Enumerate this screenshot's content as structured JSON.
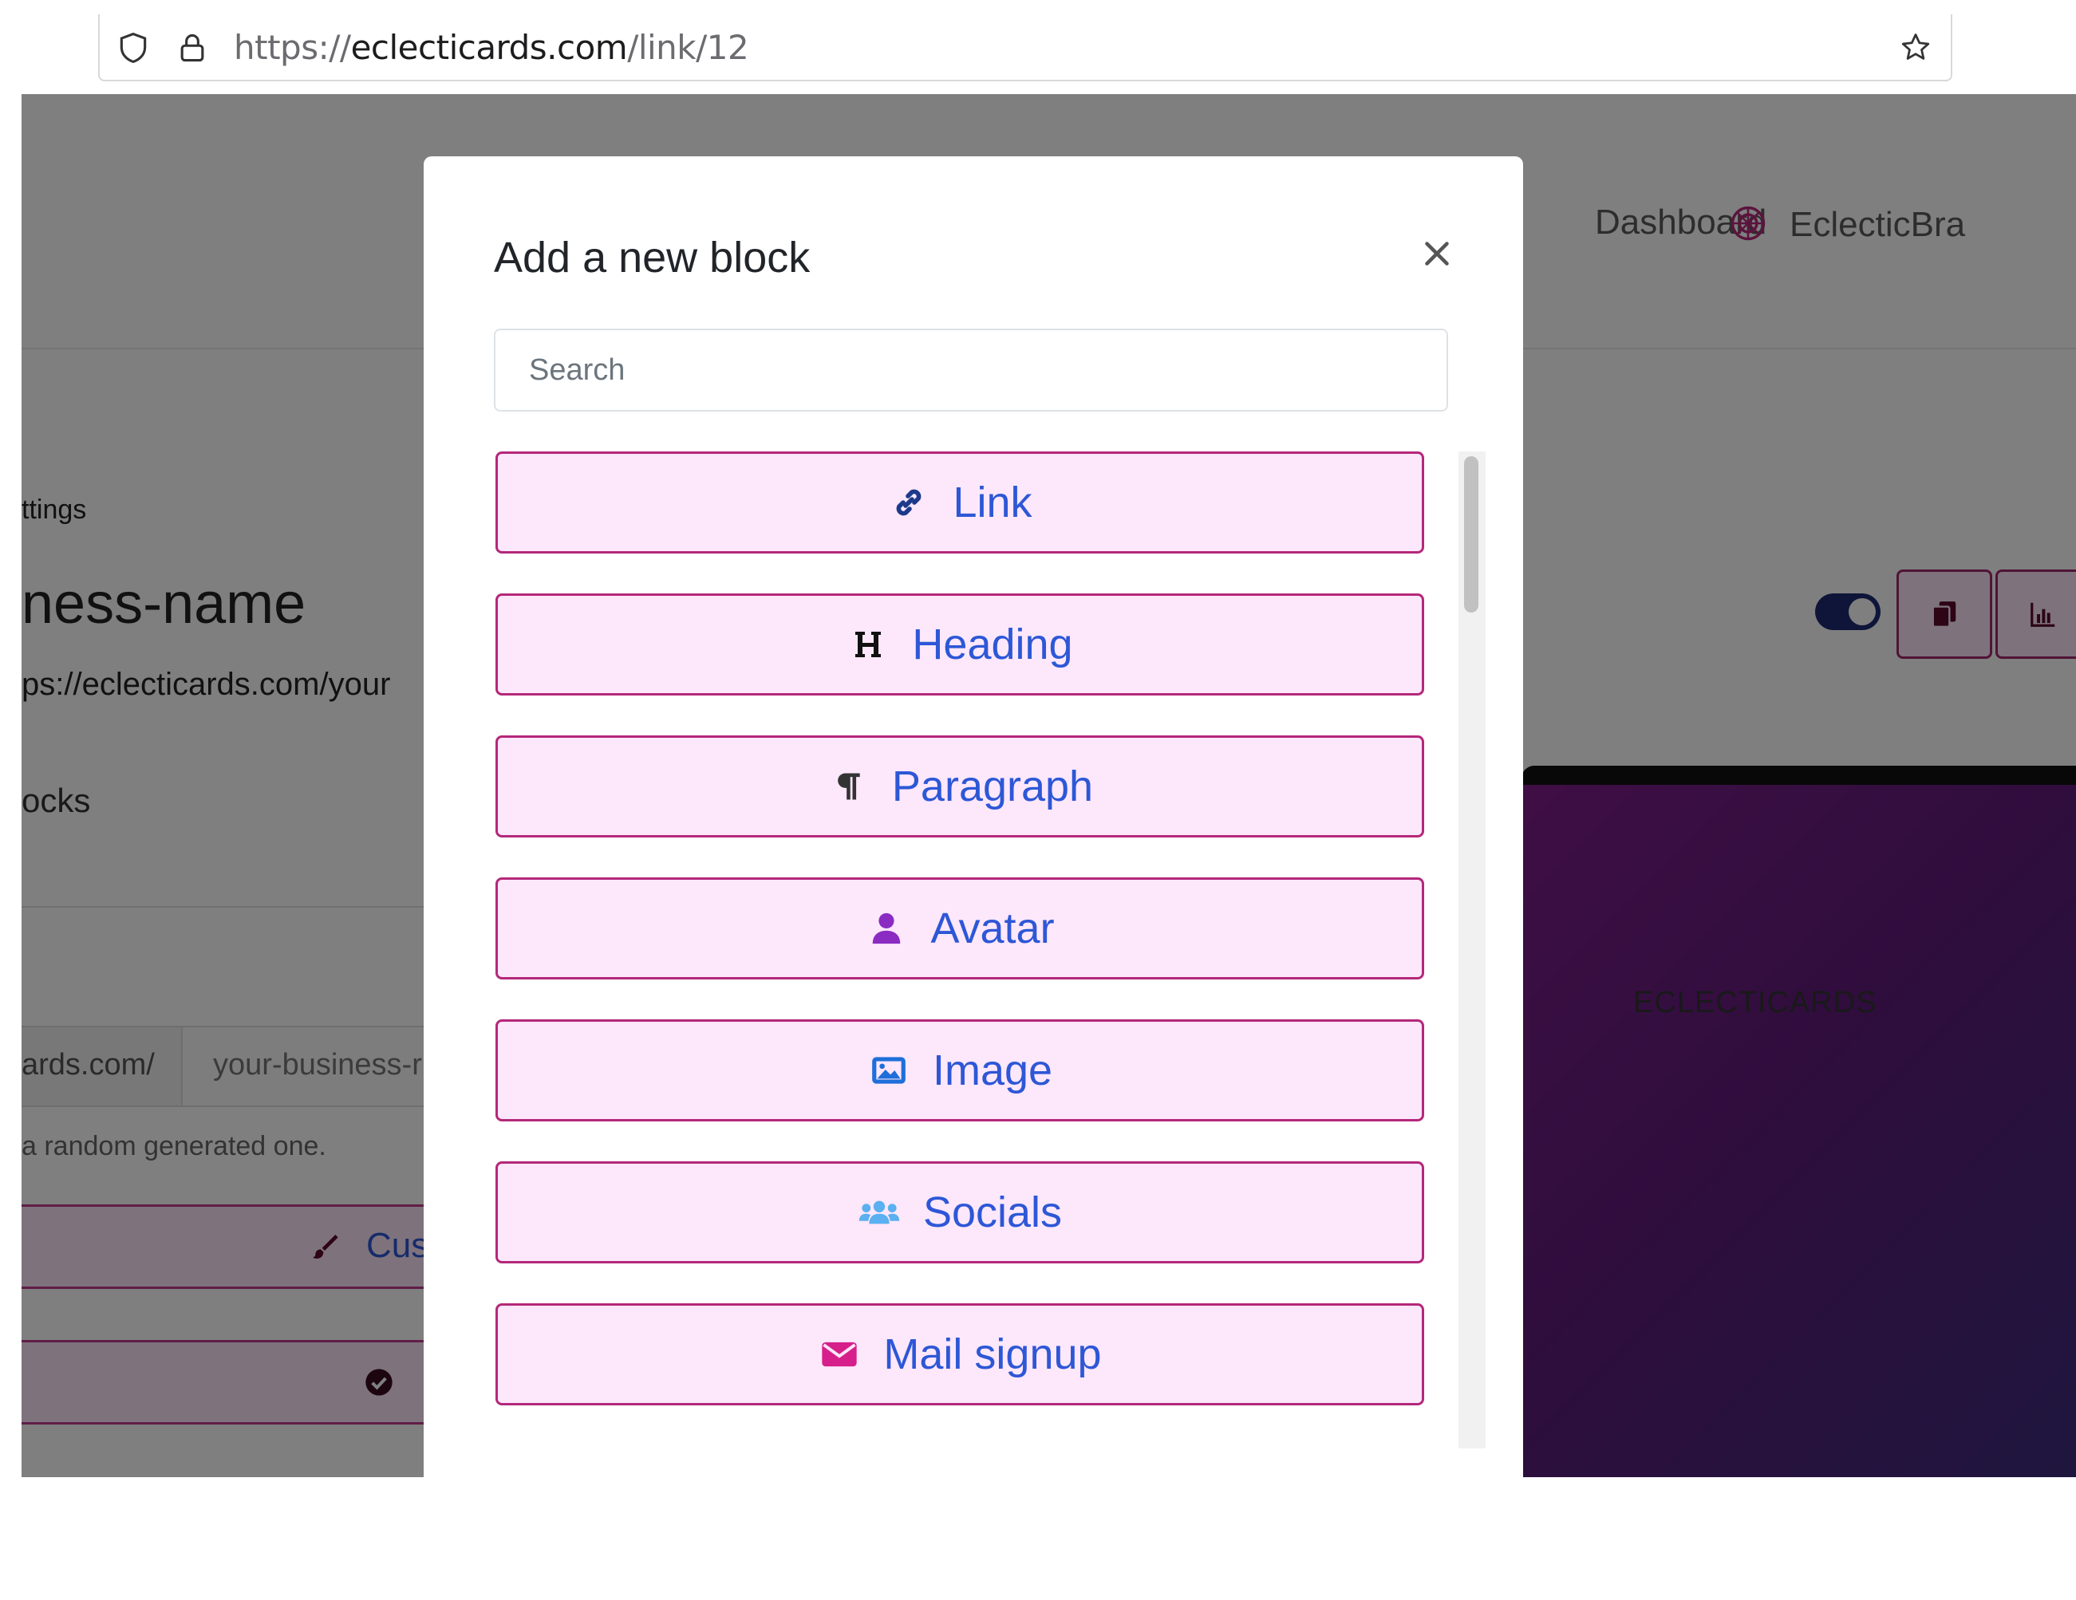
{
  "browser": {
    "url_scheme": "https://",
    "url_host": "eclecticards.com",
    "url_path": "/link/12",
    "icons": [
      "shield-icon",
      "lock-icon",
      "bookmark-star-icon"
    ]
  },
  "page": {
    "nav": {
      "dashboard": "Dashboard",
      "brand": "EclecticBra"
    },
    "settings_crumb": "ttings",
    "link_name": "ness-name",
    "link_url": "ps://eclecticards.com/your",
    "blocks_heading": "ocks",
    "url_prefix": "ards.com/",
    "url_value": "your-business-r",
    "help_text": "a random generated one.",
    "customize_label": "Cus",
    "preview_brand": "ECLECTICARDS"
  },
  "modal": {
    "title": "Add a new block",
    "search_placeholder": "Search",
    "blocks": [
      {
        "label": "Link",
        "icon": "link-icon",
        "icon_color": "#1d3a8a"
      },
      {
        "label": "Heading",
        "icon": "heading-icon",
        "icon_color": "#111111"
      },
      {
        "label": "Paragraph",
        "icon": "paragraph-icon",
        "icon_color": "#333333"
      },
      {
        "label": "Avatar",
        "icon": "user-icon",
        "icon_color": "#8a2bc2"
      },
      {
        "label": "Image",
        "icon": "image-icon",
        "icon_color": "#1e6fd9"
      },
      {
        "label": "Socials",
        "icon": "users-icon",
        "icon_color": "#5ab0f0"
      },
      {
        "label": "Mail signup",
        "icon": "envelope-icon",
        "icon_color": "#d61f8a"
      }
    ]
  },
  "colors": {
    "accent_border": "#b4287a",
    "button_fill": "#fde7fb",
    "label_blue": "#2d57d6"
  }
}
